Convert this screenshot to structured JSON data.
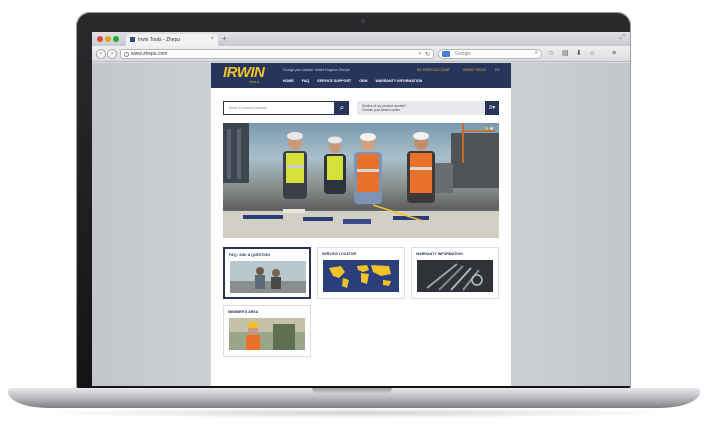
{
  "browser": {
    "tab_title": "Irwin Tools - Zhepu",
    "tab_close": "×",
    "new_tab": "+",
    "resize": "⤢",
    "url": "www.zhepu.com",
    "search_placeholder": "Google",
    "back": "‹",
    "forward": "›",
    "reload": "↻",
    "toolbar_icons": [
      "☆",
      "▤",
      "⬇",
      "⌂",
      "≡"
    ]
  },
  "site": {
    "logo": "IRWIN",
    "logo_sub": "TOOLS",
    "region_text": "Change your location: United Kingdom, Europe",
    "header_links": [
      "MY ZHEPU ACCOUNT",
      "HIRING TOOLS",
      "EN"
    ],
    "nav": [
      "HOME",
      "FAQ",
      "SERVICE SUPPORT",
      "OEM",
      "WARRANTY INFORMATION"
    ],
    "search_placeholder": "Enter a product number",
    "search_button": "⌕",
    "help_text_line1": "Service of my product number?",
    "help_text_line2": "Choose your search option",
    "menu_button": "≡▾",
    "tiles": [
      {
        "title": "FAQ / ASK A QUESTION"
      },
      {
        "title": "SERVICE LOCATOR"
      },
      {
        "title": "WARRANTY INFORMATION"
      },
      {
        "title": "MEMBER'S AREA"
      }
    ]
  },
  "colors": {
    "brand_navy": "#27355c",
    "brand_yellow": "#f2c22b",
    "hivis_orange": "#e8722a",
    "hivis_yellow": "#d6e03a"
  }
}
